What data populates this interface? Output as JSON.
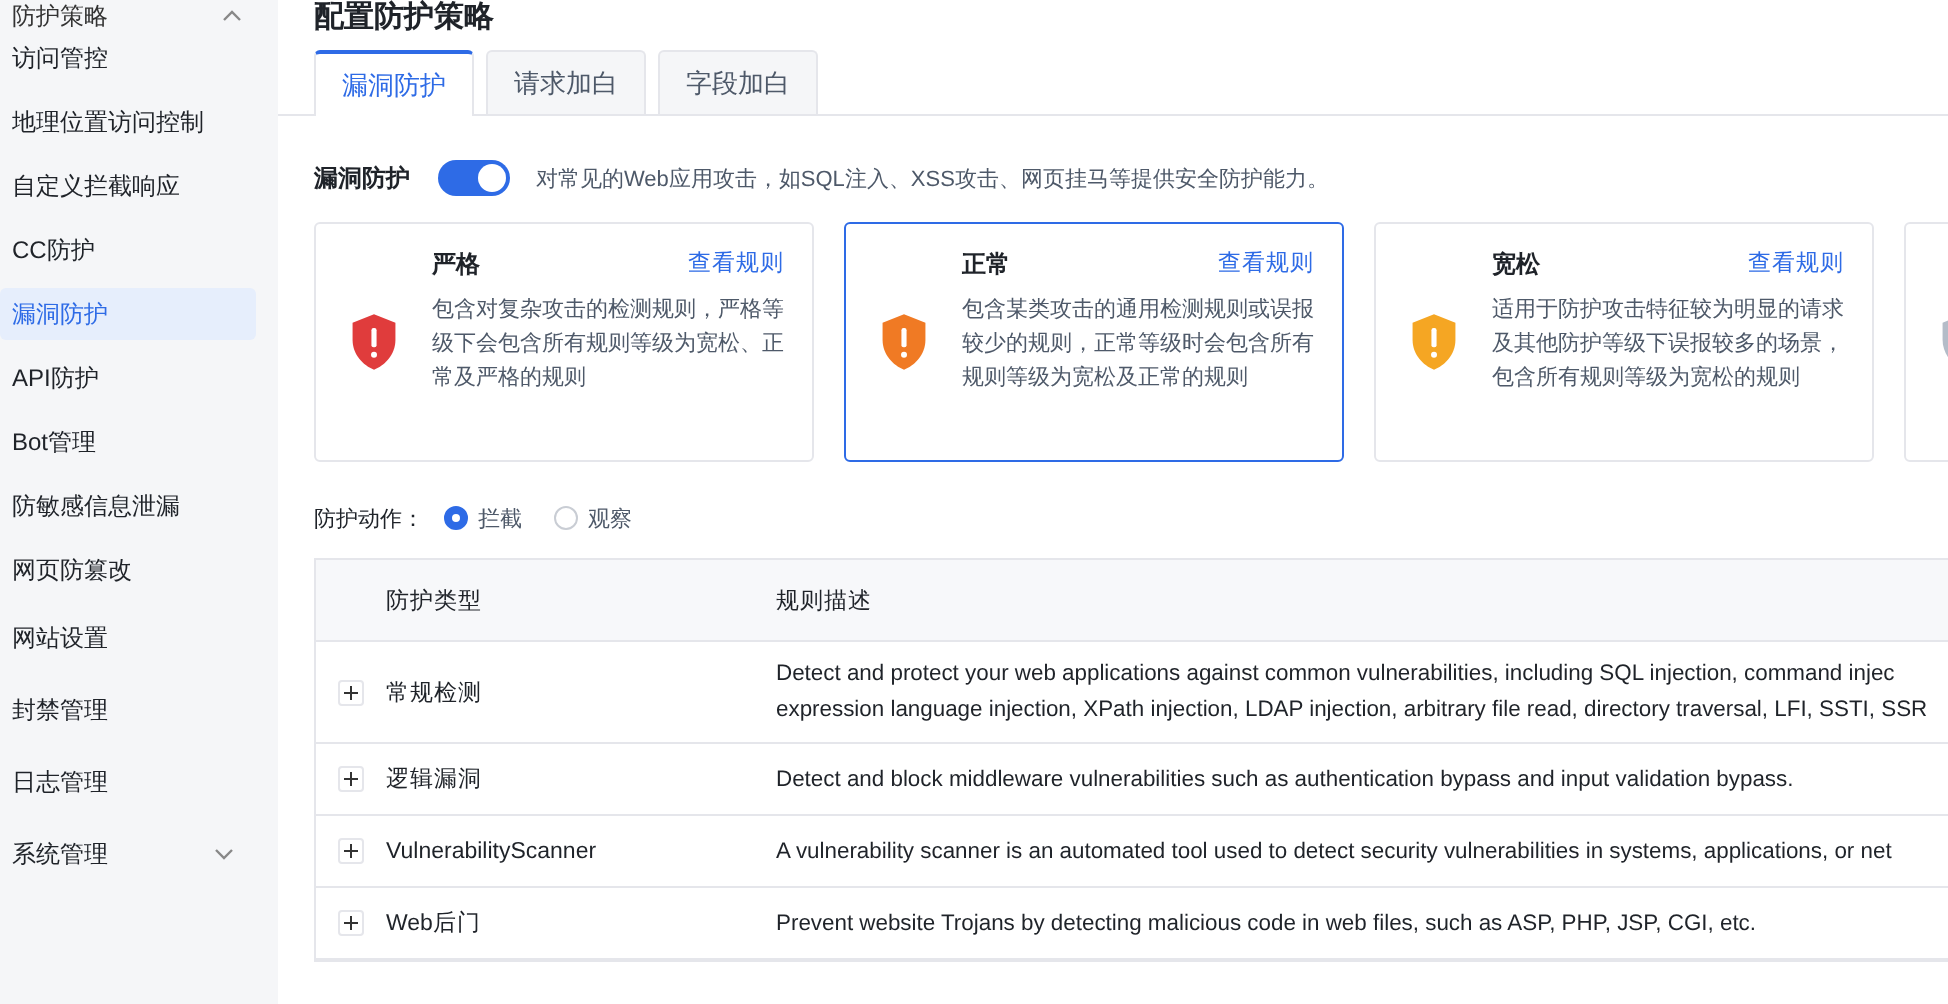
{
  "sidebar": {
    "group": {
      "label": "防护策略",
      "expanded": true
    },
    "items": [
      {
        "label": "访问管控",
        "selected": false
      },
      {
        "label": "地理位置访问控制",
        "selected": false
      },
      {
        "label": "自定义拦截响应",
        "selected": false
      },
      {
        "label": "CC防护",
        "selected": false
      },
      {
        "label": "漏洞防护",
        "selected": true
      },
      {
        "label": "API防护",
        "selected": false
      },
      {
        "label": "Bot管理",
        "selected": false
      },
      {
        "label": "防敏感信息泄漏",
        "selected": false
      }
    ],
    "sub_item": {
      "label": "网页防篡改",
      "selected": false
    },
    "sections": [
      {
        "label": "网站设置",
        "expandable": false
      },
      {
        "label": "封禁管理",
        "expandable": false
      },
      {
        "label": "日志管理",
        "expandable": false
      },
      {
        "label": "系统管理",
        "expandable": true
      }
    ]
  },
  "page_title": "配置防护策略",
  "tabs": [
    {
      "label": "漏洞防护",
      "selected": true
    },
    {
      "label": "请求加白",
      "selected": false
    },
    {
      "label": "字段加白",
      "selected": false
    }
  ],
  "protection": {
    "label": "漏洞防护",
    "on": true,
    "description": "对常见的Web应用攻击，如SQL注入、XSS攻击、网页挂马等提供安全防护能力。"
  },
  "levels": [
    {
      "title": "严格",
      "link": "查看规则",
      "description": "包含对复杂攻击的检测规则，严格等级下会包含所有规则等级为宽松、正常及严格的规则",
      "color": "#e03c3c",
      "selected": false
    },
    {
      "title": "正常",
      "link": "查看规则",
      "description": "包含某类攻击的通用检测规则或误报较少的规则，正常等级时会包含所有规则等级为宽松及正常的规则",
      "color": "#f07a24",
      "selected": true
    },
    {
      "title": "宽松",
      "link": "查看规则",
      "description": "适用于防护攻击特征较为明显的请求及其他防护等级下误报较多的场景，包含所有规则等级为宽松的规则",
      "color": "#f5a623",
      "selected": false
    },
    {
      "color": "#b4bcc8",
      "selected": false
    }
  ],
  "action": {
    "label": "防护动作：",
    "options": [
      {
        "label": "拦截",
        "selected": true
      },
      {
        "label": "观察",
        "selected": false
      }
    ]
  },
  "table": {
    "columns": [
      "防护类型",
      "规则描述"
    ],
    "rows": [
      {
        "type": "常规检测",
        "description": [
          "Detect and protect your web applications against common vulnerabilities, including SQL injection, command injec",
          "expression language injection, XPath injection, LDAP injection, arbitrary file read, directory traversal, LFI, SSTI, SSR"
        ],
        "expanded": false
      },
      {
        "type": "逻辑漏洞",
        "description": [
          "Detect and block middleware vulnerabilities such as authentication bypass and input validation bypass."
        ],
        "expanded": false
      },
      {
        "type": "VulnerabilityScanner",
        "description": [
          "A vulnerability scanner is an automated tool used to detect security vulnerabilities in systems, applications, or net"
        ],
        "expanded": false
      },
      {
        "type": "Web后门",
        "description": [
          "Prevent website Trojans by detecting malicious code in web files, such as ASP, PHP, JSP, CGI, etc."
        ],
        "expanded": false
      }
    ]
  }
}
